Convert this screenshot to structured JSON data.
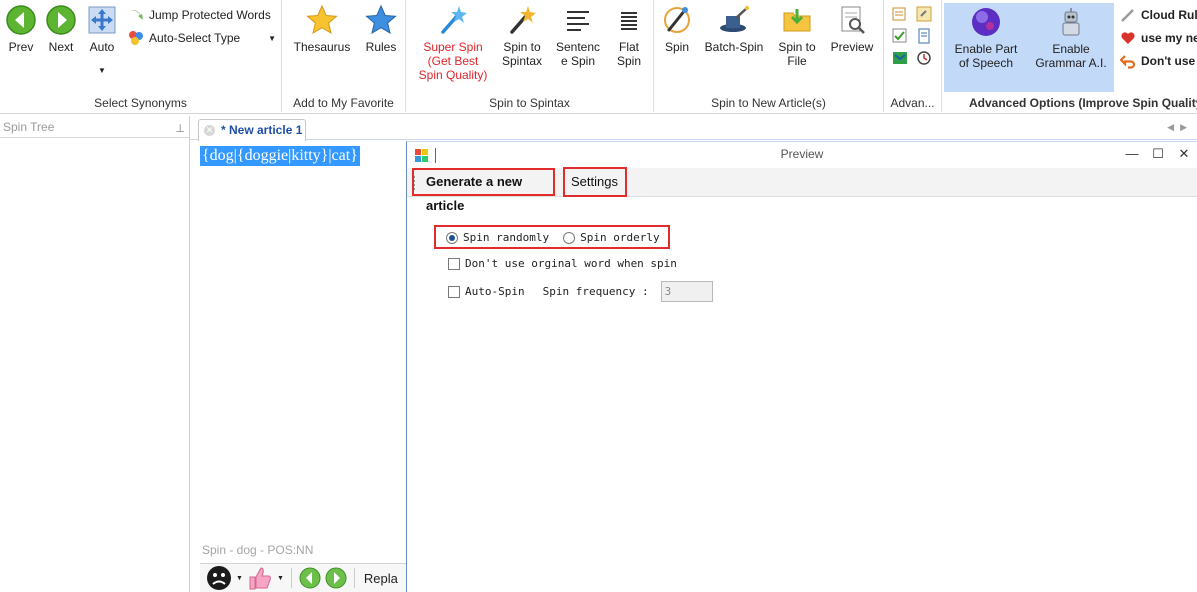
{
  "ribbon": {
    "select_synonyms": {
      "label": "Select Synonyms",
      "prev": "Prev",
      "next": "Next",
      "auto": "Auto",
      "jump_protected": "Jump Protected Words",
      "auto_select_type": "Auto-Select Type"
    },
    "favorite": {
      "label": "Add to My Favorite",
      "thesaurus": "Thesaurus",
      "rules": "Rules"
    },
    "spintax": {
      "label": "Spin to Spintax",
      "super_spin_line1": "Super Spin",
      "super_spin_line2": "(Get Best",
      "super_spin_line3": "Spin Quality)",
      "spin_to_spintax_line1": "Spin to",
      "spin_to_spintax_line2": "Spintax",
      "sentence_spin_line1": "Sentenc",
      "sentence_spin_line2": "e Spin",
      "flat_spin_line1": "Flat",
      "flat_spin_line2": "Spin"
    },
    "new_article": {
      "label": "Spin to New Article(s)",
      "spin": "Spin",
      "batch_spin": "Batch-Spin",
      "spin_to_file_line1": "Spin to",
      "spin_to_file_line2": "File",
      "preview": "Preview"
    },
    "advan": {
      "label": "Advan..."
    },
    "advanced": {
      "label": "Advanced Options (Improve Spin Quality",
      "pos_line1": "Enable Part",
      "pos_line2": "of Speech",
      "grammar_line1": "Enable",
      "grammar_line2": "Grammar A.I.",
      "cloud_rules": "Cloud Rul",
      "use_my_new": "use my ne",
      "dont_use": "Don't use"
    }
  },
  "tree": {
    "title": "Spin Tree"
  },
  "editor": {
    "tab_label": "* New article 1",
    "content": "{dog|{doggie|kitty}|cat}",
    "status": "Spin - dog - POS:NN",
    "replace_label": "Repla"
  },
  "dialog": {
    "title": "Preview",
    "toolbar": {
      "generate": "Generate a new article",
      "settings": "Settings"
    },
    "settings": {
      "spin_randomly": "Spin randomly",
      "spin_orderly": "Spin orderly",
      "dont_use_original": "Don't use orginal word when spin",
      "auto_spin": "Auto-Spin",
      "spin_frequency": "Spin frequency :",
      "frequency_value": "3"
    }
  },
  "colors": {
    "highlight_box": "#e02c2c",
    "selection": "#3399ff",
    "super_spin_red": "#e0242a",
    "tab_text": "#1e4ea8",
    "advanced_bg": "#c2d9f8"
  }
}
